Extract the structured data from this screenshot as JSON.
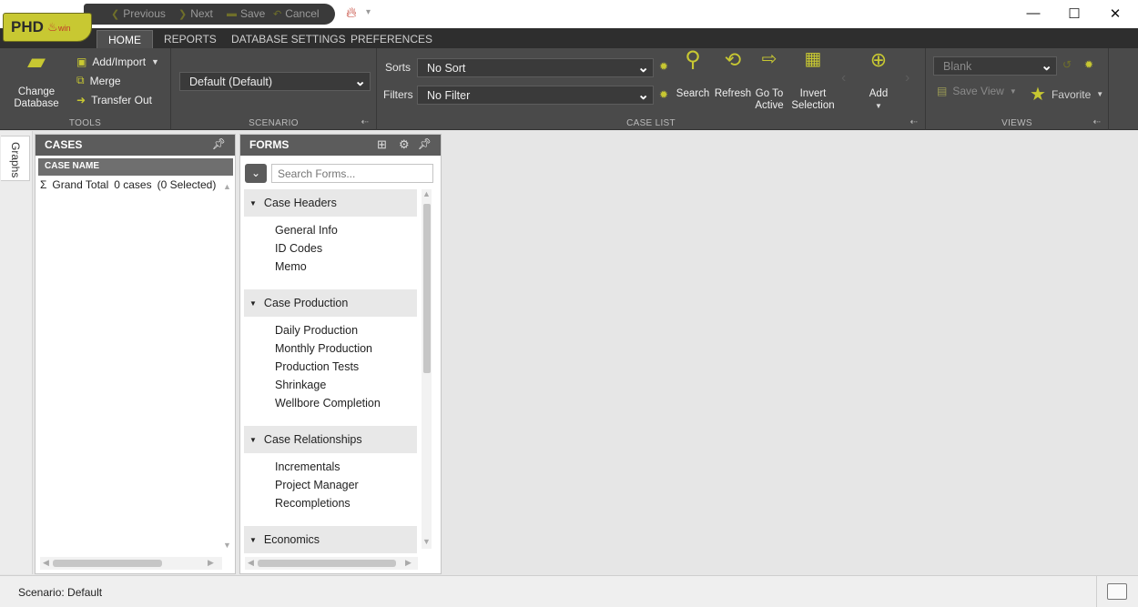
{
  "app": {
    "logo_text": "PHD",
    "logo_suffix": "win"
  },
  "qat": {
    "previous": "Previous",
    "next": "Next",
    "save": "Save",
    "cancel": "Cancel"
  },
  "tabs": [
    "HOME",
    "REPORTS",
    "DATABASE SETTINGS",
    "PREFERENCES"
  ],
  "ribbon": {
    "tools": {
      "label": "TOOLS",
      "change_database": [
        "Change",
        "Database"
      ],
      "add_import": "Add/Import",
      "merge": "Merge",
      "transfer_out": "Transfer Out"
    },
    "scenario": {
      "label": "SCENARIO",
      "value": "Default (Default)"
    },
    "case_list": {
      "label": "CASE LIST",
      "sorts_label": "Sorts",
      "sorts_value": "No Sort",
      "filters_label": "Filters",
      "filters_value": "No Filter",
      "search": "Search",
      "refresh": "Refresh",
      "go_to_active": [
        "Go To",
        "Active"
      ],
      "invert_selection": [
        "Invert",
        "Selection"
      ],
      "add": "Add"
    },
    "views": {
      "label": "VIEWS",
      "value": "Blank",
      "save_view": "Save View",
      "favorite": "Favorite"
    }
  },
  "sidestrip": {
    "graphs": "Graphs"
  },
  "cases_panel": {
    "title": "CASES",
    "column": "CASE NAME",
    "total_label": "Grand Total",
    "total_count": "0 cases",
    "total_selected": "(0 Selected)"
  },
  "forms_panel": {
    "title": "FORMS",
    "search_placeholder": "Search Forms...",
    "sections": [
      {
        "title": "Case Headers",
        "items": [
          "General Info",
          "ID Codes",
          "Memo"
        ]
      },
      {
        "title": "Case Production",
        "items": [
          "Daily Production",
          "Monthly Production",
          "Production Tests",
          "Shrinkage",
          "Wellbore Completion"
        ]
      },
      {
        "title": "Case Relationships",
        "items": [
          "Incrementals",
          "Project Manager",
          "Recompletions"
        ]
      },
      {
        "title": "Economics",
        "items": []
      }
    ]
  },
  "status": {
    "scenario_label": "Scenario:",
    "scenario_value": "Default"
  },
  "colors": {
    "accent": "#c8c832",
    "ribbon_bg": "#4a4a4a",
    "panel_header": "#5c5c5c"
  }
}
